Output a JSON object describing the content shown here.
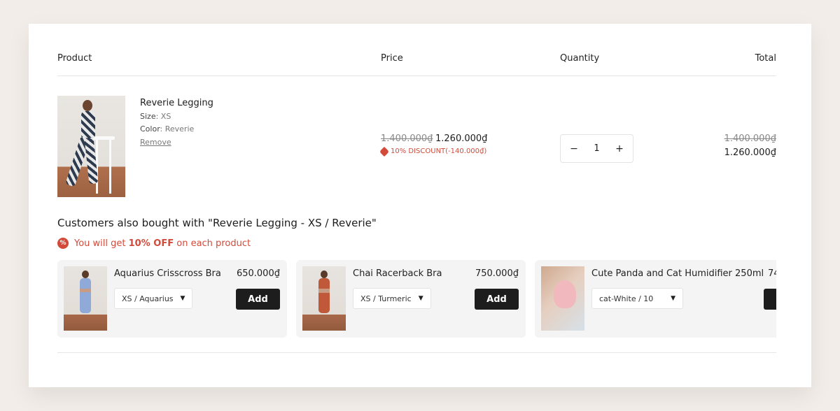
{
  "headers": {
    "product": "Product",
    "price": "Price",
    "quantity": "Quantity",
    "total": "Total"
  },
  "item": {
    "name": "Reverie Legging",
    "size_label": "Size",
    "size": "XS",
    "color_label": "Color",
    "color": "Reverie",
    "remove": "Remove",
    "price_old": "1.400.000₫",
    "price_new": "1.260.000₫",
    "discount": "10% DISCOUNT(-140.000₫)",
    "quantity": "1",
    "qty_minus": "−",
    "qty_plus": "+",
    "total_old": "1.400.000₫",
    "total_new": "1.260.000₫"
  },
  "upsell": {
    "title": "Customers also bought with \"Reverie Legging - XS / Reverie\"",
    "note_prefix": "You will get",
    "note_bold": "10% OFF",
    "note_suffix": "on each product",
    "badge": "%",
    "add_label": "Add",
    "products": [
      {
        "name": "Aquarius Crisscross Bra",
        "price": "650.000₫",
        "variant": "XS / Aquarius"
      },
      {
        "name": "Chai Racerback Bra",
        "price": "750.000₫",
        "variant": "XS / Turmeric"
      },
      {
        "name": "Cute Panda and Cat Humidifier 250ml",
        "price": "74",
        "variant": "cat-White / 10"
      }
    ]
  },
  "colors": {
    "accent": "#d24b3a",
    "button": "#1d1d1d",
    "background": "#f2ede8"
  }
}
